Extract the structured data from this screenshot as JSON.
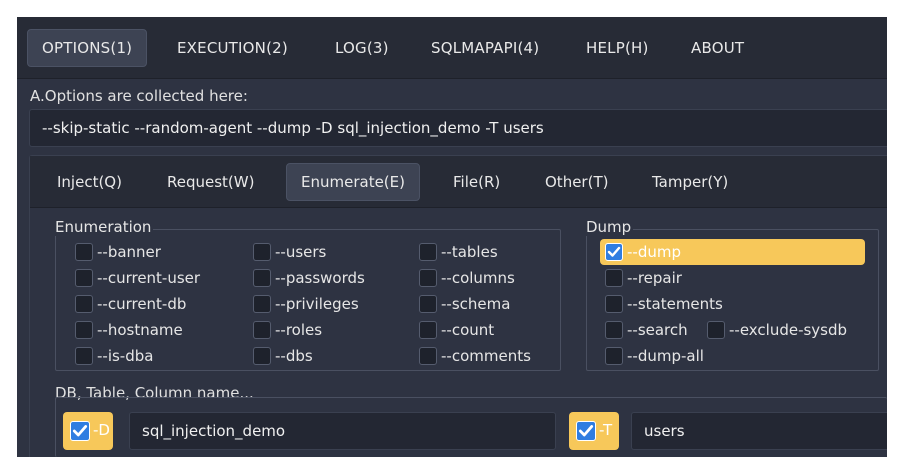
{
  "menu": [
    {
      "label": "OPTIONS(1)",
      "active": true
    },
    {
      "label": "EXECUTION(2)"
    },
    {
      "label": "LOG(3)"
    },
    {
      "label": "SQLMAPAPI(4)"
    },
    {
      "label": "HELP(H)"
    },
    {
      "label": "ABOUT"
    }
  ],
  "options": {
    "label": "A.Options are collected here:",
    "value": "--skip-static --random-agent --dump -D sql_injection_demo -T users"
  },
  "tabs": [
    {
      "label": "Inject(Q)"
    },
    {
      "label": "Request(W)"
    },
    {
      "label": "Enumerate(E)",
      "active": true
    },
    {
      "label": "File(R)"
    },
    {
      "label": "Other(T)"
    },
    {
      "label": "Tamper(Y)"
    }
  ],
  "enumeration": {
    "title": "Enumeration",
    "col1": [
      "--banner",
      "--current-user",
      "--current-db",
      "--hostname",
      "--is-dba"
    ],
    "col2": [
      "--users",
      "--passwords",
      "--privileges",
      "--roles",
      "--dbs"
    ],
    "col3": [
      "--tables",
      "--columns",
      "--schema",
      "--count",
      "--comments"
    ]
  },
  "dump": {
    "title": "Dump",
    "items": [
      "--dump",
      "--repair",
      "--statements",
      "--search",
      "--exclude-sysdb",
      "--dump-all"
    ],
    "checked": [
      "--dump"
    ]
  },
  "names": {
    "title": "DB, Table, Column name...",
    "db_toggle": "-D",
    "db_value": "sql_injection_demo",
    "table_toggle": "-T",
    "table_value": "users"
  },
  "colors": {
    "background": "#2e3342",
    "highlight": "#f7c85a",
    "checkbox_checked": "#2f7de1"
  }
}
